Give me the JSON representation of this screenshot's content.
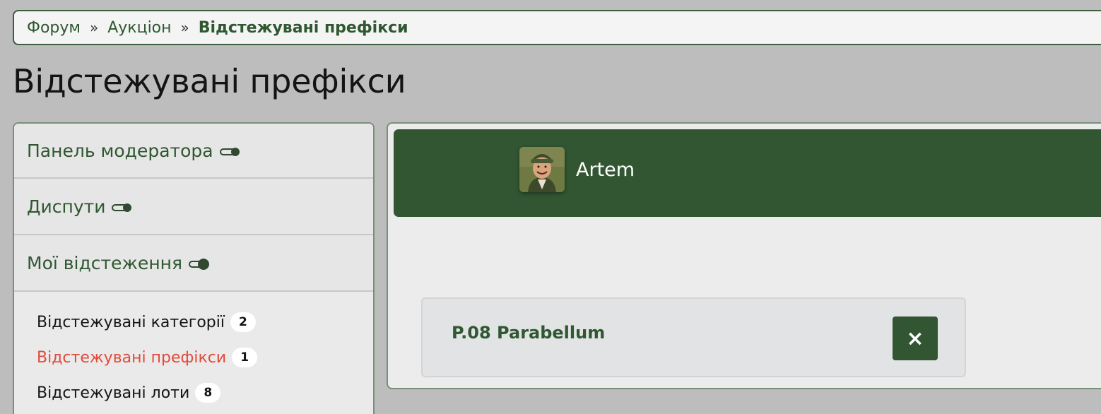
{
  "breadcrumb": {
    "items": [
      "Форум",
      "Аукціон"
    ],
    "separator": "»",
    "current": "Відстежувані префікси"
  },
  "page_title": "Відстежувані префікси",
  "sidebar": {
    "sections": [
      {
        "label": "Панель модератора",
        "toggle": "collapsed"
      },
      {
        "label": "Диспути",
        "toggle": "collapsed"
      },
      {
        "label": "Мої відстеження",
        "toggle": "expanded"
      }
    ],
    "items": [
      {
        "label": "Відстежувані категорії",
        "count": "2"
      },
      {
        "label": "Відстежувані префікси",
        "count": "1"
      },
      {
        "label": "Відстежувані лоти",
        "count": "8"
      }
    ]
  },
  "user": {
    "name": "Artem"
  },
  "prefix": {
    "name": "P.08 Parabellum",
    "remove_icon": "×"
  },
  "colors": {
    "brand_green": "#325632",
    "link_green": "#2f5730",
    "active_red": "#e24a3b"
  }
}
